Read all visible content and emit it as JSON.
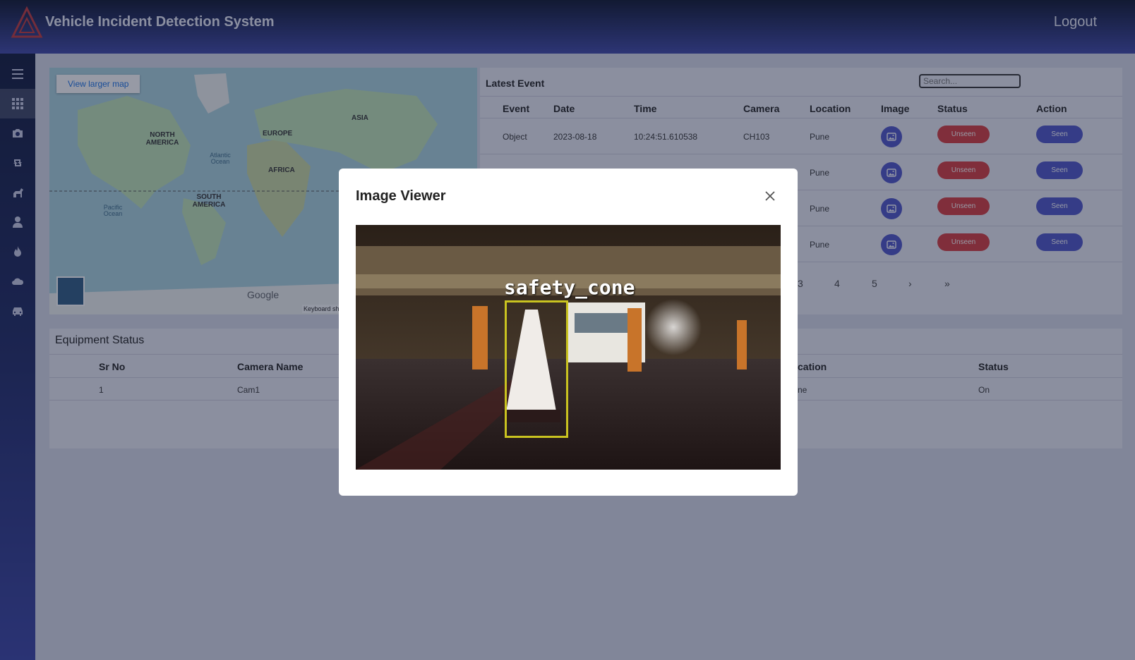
{
  "header": {
    "title": "Vehicle Incident Detection System",
    "logout_label": "Logout"
  },
  "sidebar": {
    "items": [
      {
        "icon": "menu-icon",
        "active": false
      },
      {
        "icon": "grid-icon",
        "active": true
      },
      {
        "icon": "camera-icon",
        "active": false
      },
      {
        "icon": "retweet-icon",
        "active": false
      },
      {
        "icon": "horse-icon",
        "active": false
      },
      {
        "icon": "user-icon",
        "active": false
      },
      {
        "icon": "fire-icon",
        "active": false
      },
      {
        "icon": "cloud-icon",
        "active": false
      },
      {
        "icon": "car-icon",
        "active": false
      }
    ]
  },
  "map": {
    "button_label": "View larger map",
    "labels": {
      "north_america": "NORTH AMERICA",
      "europe": "EUROPE",
      "asia": "ASIA",
      "africa": "AFRICA",
      "south_america": "SOUTH AMERICA",
      "atlantic": "Atlantic Ocean",
      "pacific": "Pacific Ocean"
    },
    "google_text": "Google",
    "keyboard_text": "Keyboard sh"
  },
  "latest_event": {
    "title": "Latest Event",
    "search_placeholder": "Search...",
    "columns": [
      "Event",
      "Date",
      "Time",
      "Camera",
      "Location",
      "Image",
      "Status",
      "Action"
    ],
    "rows": [
      {
        "event": "Object",
        "date": "2023-08-18",
        "time": "10:24:51.610538",
        "camera": "CH103",
        "location": "Pune",
        "status": "Unseen",
        "action": "Seen"
      },
      {
        "event": "",
        "date": "",
        "time": "",
        "camera": "",
        "location": "Pune",
        "status": "Unseen",
        "action": "Seen"
      },
      {
        "event": "",
        "date": "",
        "time": "",
        "camera": "",
        "location": "Pune",
        "status": "Unseen",
        "action": "Seen"
      },
      {
        "event": "",
        "date": "",
        "time": "",
        "camera": "",
        "location": "Pune",
        "status": "Unseen",
        "action": "Seen"
      }
    ],
    "pagination": [
      "3",
      "4",
      "5",
      "›",
      "»"
    ]
  },
  "equipment": {
    "title": "Equipment Status",
    "columns": {
      "sr_no": "Sr No",
      "camera_name": "Camera Name",
      "location": "cation",
      "status": "Status"
    },
    "rows": [
      {
        "sr_no": "1",
        "camera_name": "Cam1",
        "location": "ne",
        "status": "On"
      }
    ]
  },
  "modal": {
    "title": "Image Viewer",
    "detection_label": "safety_cone"
  },
  "colors": {
    "accent": "#4e55c8",
    "danger": "#d63b3e",
    "header_dark": "#0e1630"
  }
}
